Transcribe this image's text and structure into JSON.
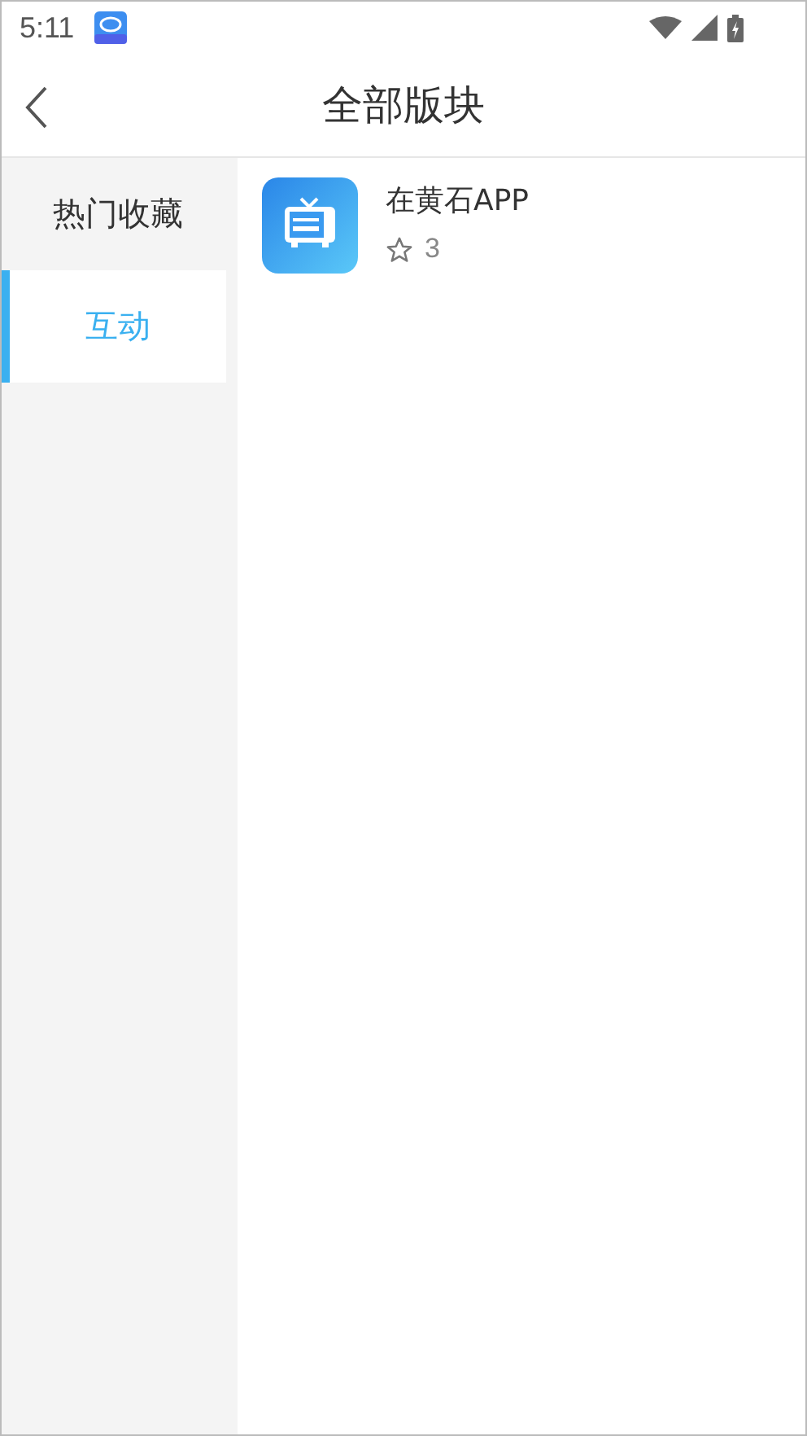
{
  "status_bar": {
    "time": "5:11"
  },
  "header": {
    "title": "全部版块"
  },
  "sidebar": {
    "items": [
      {
        "label": "热门收藏",
        "selected": false
      },
      {
        "label": "互动",
        "selected": true
      }
    ]
  },
  "forums": [
    {
      "name": "在黄石APP",
      "stars": "3"
    }
  ]
}
